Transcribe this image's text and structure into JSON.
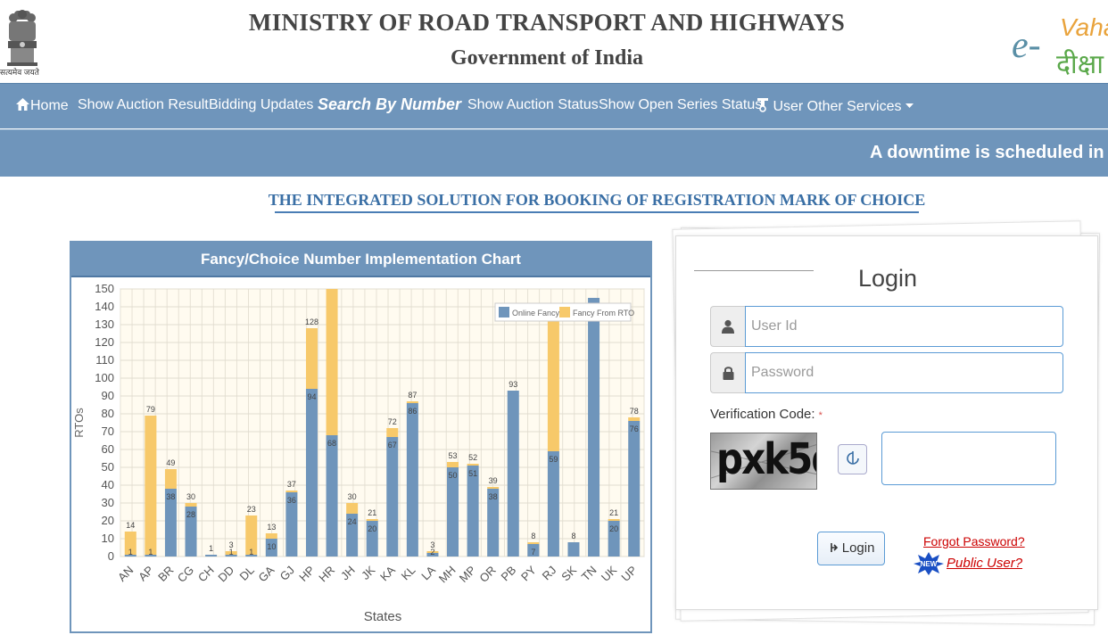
{
  "header": {
    "ministry": "MINISTRY OF ROAD TRANSPORT AND HIGHWAYS",
    "government": "Government of India",
    "emblem_motto": "सत्यमेव जयते",
    "brand_prefix": "e-",
    "brand_top": "Vahan",
    "brand_bottom": "दीक्षा"
  },
  "nav": {
    "items": [
      {
        "label": "Home",
        "icon": "home-icon"
      },
      {
        "label": "Show Auction Result"
      },
      {
        "label": "Bidding Updates"
      },
      {
        "label": "Search By Number",
        "active": true
      },
      {
        "label": "Show Auction Status"
      },
      {
        "label": "Show Open Series Status"
      },
      {
        "label": "User Other Services",
        "icon": "user-services-icon",
        "dropdown": true
      }
    ]
  },
  "ticker": {
    "text": "A downtime is scheduled in th"
  },
  "tagline": "THE INTEGRATED SOLUTION FOR BOOKING OF REGISTRATION MARK OF CHOICE",
  "chart_panel": {
    "title": "Fancy/Choice Number Implementation Chart"
  },
  "chart_data": {
    "type": "bar",
    "title": "Fancy/Choice Number Implementation Chart",
    "xlabel": "States",
    "ylabel": "RTOs",
    "ylim": [
      0,
      150
    ],
    "yticks": [
      0,
      10,
      20,
      30,
      40,
      50,
      60,
      70,
      80,
      90,
      100,
      110,
      120,
      130,
      140,
      150
    ],
    "grid": true,
    "stacked": true,
    "legend_position": "top-right",
    "categories": [
      "AN",
      "AP",
      "BR",
      "CG",
      "CH",
      "DD",
      "DL",
      "GA",
      "GJ",
      "HP",
      "HR",
      "JH",
      "JK",
      "KA",
      "KL",
      "LA",
      "MH",
      "MP",
      "OR",
      "PB",
      "PY",
      "RJ",
      "SK",
      "TN",
      "UK",
      "UP"
    ],
    "series": [
      {
        "name": "Online Fancy",
        "color": "#6f95bb",
        "values": [
          1,
          1,
          38,
          28,
          1,
          1,
          1,
          10,
          36,
          94,
          68,
          24,
          20,
          67,
          86,
          2,
          50,
          51,
          38,
          93,
          7,
          59,
          8,
          145,
          20,
          76
        ]
      },
      {
        "name": "Fancy From RTO",
        "color": "#f7c96a",
        "values": [
          13,
          78,
          11,
          2,
          0,
          2,
          22,
          3,
          1,
          34,
          82,
          6,
          1,
          5,
          1,
          1,
          3,
          1,
          1,
          0,
          1,
          75,
          0,
          0,
          1,
          2
        ]
      }
    ],
    "value_labels": [
      {
        "top": "14",
        "low": "1"
      },
      {
        "top": "79",
        "low": "1"
      },
      {
        "top": "49",
        "low": "38"
      },
      {
        "top": "30",
        "low": "28"
      },
      {
        "top": "1",
        "low": ""
      },
      {
        "top": "3",
        "low": "1"
      },
      {
        "top": "23",
        "low": "1"
      },
      {
        "top": "13",
        "low": "10"
      },
      {
        "top": "37",
        "low": "36"
      },
      {
        "top": "128",
        "low": "94"
      },
      {
        "top": "",
        "low": "68"
      },
      {
        "top": "30",
        "low": "24"
      },
      {
        "top": "21",
        "low": "20"
      },
      {
        "top": "72",
        "low": "67"
      },
      {
        "top": "87",
        "low": "86"
      },
      {
        "top": "3",
        "low": "2"
      },
      {
        "top": "53",
        "low": "50"
      },
      {
        "top": "52",
        "low": "51"
      },
      {
        "top": "39",
        "low": "38"
      },
      {
        "top": "93",
        "low": ""
      },
      {
        "top": "8",
        "low": "7"
      },
      {
        "top": "",
        "low": "59"
      },
      {
        "top": "8",
        "low": ""
      },
      {
        "top": "",
        "low": ""
      },
      {
        "top": "21",
        "low": "20"
      },
      {
        "top": "78",
        "low": "76"
      }
    ]
  },
  "login": {
    "title": "Login",
    "user_placeholder": "User Id",
    "password_placeholder": "Password",
    "verification_label": "Verification Code:",
    "required_mark": "*",
    "captcha_text": "pxk5d",
    "login_button": "Login",
    "forgot_password": "Forgot Password?",
    "public_user": "Public User?",
    "new_badge": "NEW"
  }
}
